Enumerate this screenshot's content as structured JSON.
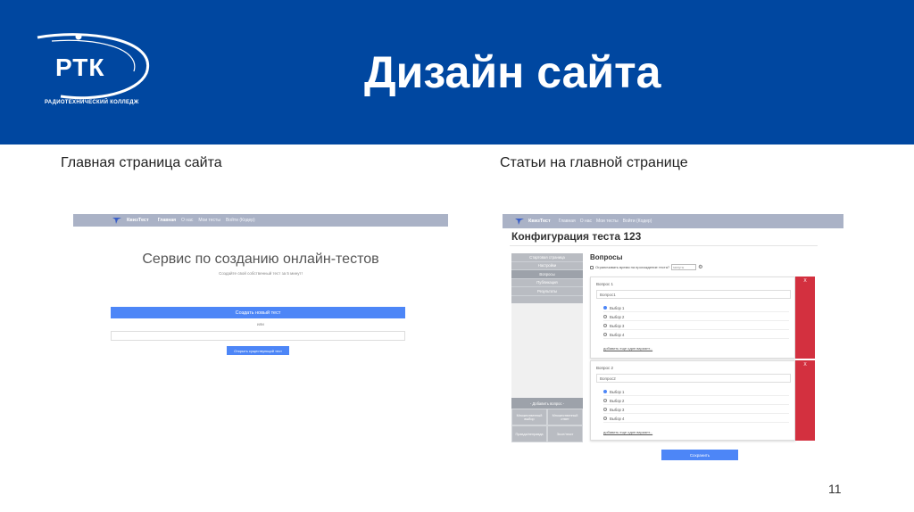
{
  "slide": {
    "title": "Дизайн сайта",
    "page_number": "11",
    "caption_left": "Главная страница сайта",
    "caption_right": "Статьи на главной странице"
  },
  "logo": {
    "text": "РТК",
    "subtitle": "РАДИОТЕХНИЧЕСКИЙ КОЛЛЕДЖ"
  },
  "colors": {
    "header_blue": "#0047a0",
    "nav_gray": "#aab2c6",
    "button_blue": "#4d86f7",
    "delete_red": "#d3303f"
  },
  "home_screen": {
    "brand": "КвизТест",
    "nav": [
      "Главная",
      "О нас",
      "Мои тесты",
      "Войти (Кодер)"
    ],
    "hero_title": "Сервис по созданию онлайн-тестов",
    "hero_subtitle": "Создайте свой собственный тест за 5 минут!",
    "create_button": "Создать новый тест",
    "or_text": "или",
    "open_button": "Открыть существующий тест"
  },
  "config_screen": {
    "brand": "КвизТест",
    "nav": [
      "Главная",
      "О нас",
      "Мои тесты",
      "Войти (Кодер)"
    ],
    "title": "Конфигурация теста 123",
    "side_menu": [
      "Стартовая страница",
      "Настройки",
      "Вопросы",
      "Публикация",
      "Результаты"
    ],
    "add_question_label": "- Добавить вопрос -",
    "add_types": [
      "Множественный выбор",
      "Множественный ответ",
      "Правда/неправда",
      "Эссе/текст"
    ],
    "questions_header": "Вопросы",
    "limit_time_label": "Ограничивать время на прохождение теста?",
    "limit_time_placeholder": "минуты",
    "questions": [
      {
        "label": "Вопрос 1",
        "value": "Вопрос1",
        "options": [
          "Выбор 1",
          "Выбор 2",
          "Выбор 3",
          "Выбор 4"
        ],
        "add_option": "добавить еще один вариант..."
      },
      {
        "label": "Вопрос 2",
        "value": "Вопрос2",
        "options": [
          "Выбор 1",
          "Выбор 2",
          "Выбор 3",
          "Выбор 4"
        ],
        "add_option": "добавить еще один вариант..."
      }
    ],
    "delete_label": "X",
    "save_button": "Сохранить"
  }
}
